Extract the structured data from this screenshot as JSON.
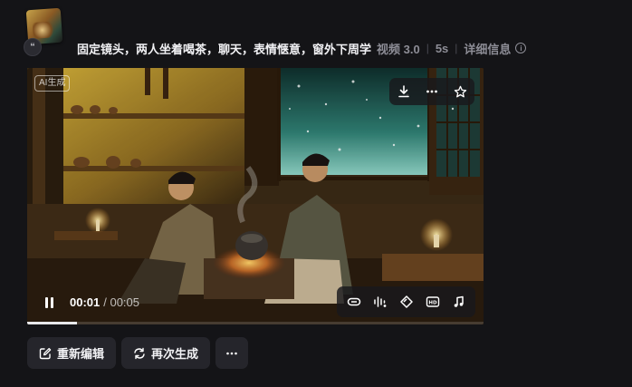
{
  "header": {
    "prompt": "固定镜头，两人坐着喝茶，聊天，表情惬意，窗外下周学",
    "model": "视频 3.0",
    "duration": "5s",
    "details_label": "详细信息",
    "quote_icon": "quote-icon"
  },
  "video": {
    "ai_badge": "AI生成",
    "time_current": "00:01",
    "time_total": "/ 00:05",
    "progress": 0.11,
    "top_actions": [
      "download-icon",
      "more-icon",
      "star-icon"
    ],
    "tools": [
      "loop-icon",
      "audio-wave-icon",
      "diamond-icon",
      "hd-icon",
      "music-icon"
    ]
  },
  "actions": {
    "reedit": "重新编辑",
    "regenerate": "再次生成",
    "more_icon": "more-horizontal-icon"
  },
  "colors": {
    "background": "#141417",
    "button_bg": "#25252b",
    "muted_text": "#8d8d96"
  }
}
